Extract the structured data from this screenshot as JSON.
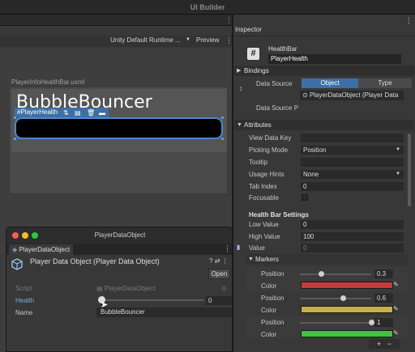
{
  "app": {
    "title": "UI Builder"
  },
  "canvas": {
    "theme_select": "Unity Default Runtime ...",
    "preview_label": "Preview",
    "document_label": "PlayerInfoHealthBar.uxml",
    "game_title": "BubbleBouncer",
    "selection_tag": "#PlayerHealth"
  },
  "pdo_window": {
    "title": "PlayerDataObject",
    "tab_label": "PlayerDataObject",
    "header_title": "Player Data Object (Player Data Object)",
    "open_label": "Open",
    "fields": {
      "script_label": "Script",
      "script_value": "PlayerDataObject",
      "health_label": "Health",
      "health_value": "0",
      "name_label": "Name",
      "name_value": "BubbleBouncer"
    },
    "health_fraction": 0
  },
  "inspector": {
    "tab_label": "Inspector",
    "element_type": "HealthBar",
    "element_name": "PlayerHealth",
    "bindings": {
      "section_label": "Bindings",
      "data_source_label": "Data Source",
      "object_btn": "Object",
      "type_btn": "Type",
      "data_source_value": "PlayerDataObject (Player Data",
      "data_source_path_label": "Data Source P"
    },
    "attributes": {
      "section_label": "Attributes",
      "view_data_key_label": "View Data Key",
      "picking_mode_label": "Picking Mode",
      "picking_mode_value": "Position",
      "tooltip_label": "Tooltip",
      "usage_hints_label": "Usage Hints",
      "usage_hints_value": "None",
      "tab_index_label": "Tab Index",
      "tab_index_value": "0",
      "focusable_label": "Focusable"
    },
    "health_bar_settings": {
      "section_label": "Health Bar Settings",
      "low_value_label": "Low Value",
      "low_value": "0",
      "high_value_label": "High Value",
      "high_value": "100",
      "value_label": "Value",
      "value": "0"
    },
    "markers": {
      "section_label": "Markers",
      "position_label": "Position",
      "color_label": "Color",
      "items": [
        {
          "position": "0.3",
          "position_num": 0.3,
          "color": "#c53a3a"
        },
        {
          "position": "0.6",
          "position_num": 0.6,
          "color": "#c9b040"
        },
        {
          "position": "1",
          "position_num": 1,
          "color": "#3ec43e"
        }
      ],
      "add_label": "+",
      "remove_label": "−"
    }
  },
  "colors": {
    "accent": "#3d6fa6",
    "selection_border": "#4a88cf",
    "close": "#ee5f57",
    "minimize": "#f5bd2f",
    "maximize": "#28c840"
  }
}
